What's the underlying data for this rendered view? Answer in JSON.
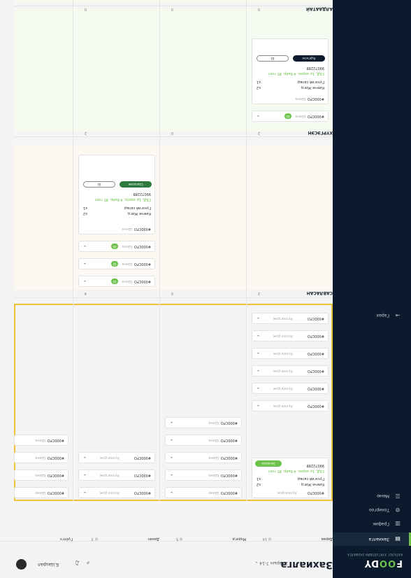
{
  "brand": {
    "name_pre": "F",
    "name_oo": "OO",
    "name_post": "DY",
    "tagline": "КАТАЛОГ ХҮРГЭЛТИЙН ЗАХИАЛГА"
  },
  "sidebar": {
    "items": [
      {
        "label": "Захиалга",
        "icon": "orders-icon",
        "active": true
      },
      {
        "label": "График",
        "icon": "chart-icon"
      },
      {
        "label": "Тохиргоо",
        "icon": "gear-icon"
      },
      {
        "label": "Меню",
        "icon": "menu-icon"
      }
    ],
    "logout": "Гарах"
  },
  "header": {
    "title": "Захиалга",
    "date": "2 сарын 7-14",
    "user": "Б.Цацрал"
  },
  "board": {
    "columns": [
      "Дараа",
      "Мэдэгд",
      "Дахин",
      "Гүйлгэ"
    ],
    "counts": [
      "14",
      "5",
      "3",
      "1"
    ],
    "sections": {
      "cook": {
        "label": "САВЛАСАН",
        "counts": [
          "2",
          "0",
          "4"
        ]
      },
      "ready": {
        "label": "ХҮРГЭСЭН",
        "counts": [
          "2",
          "0",
          "2"
        ]
      },
      "deliver": {
        "label": "АЛДААТАЙ",
        "counts": [
          "0",
          "0",
          "0"
        ]
      }
    },
    "order_id": "#000CFO",
    "status_new": "Шинэ",
    "status_wait": "Хүлээгдэж",
    "badge": "82",
    "item1": "Кимчи Жигд",
    "item1_qty": "x2",
    "item2": "Гүнзгий салад",
    "item2_qty": "x1",
    "address": "СБД, 1р хороо, 4 байр, 85 тоот",
    "phone": "99072288",
    "btn_accept": "Захиалах",
    "btn_pack": "Савлалаж",
    "btn_deliver": "Хүргэсэн",
    "btn_count": "82"
  }
}
